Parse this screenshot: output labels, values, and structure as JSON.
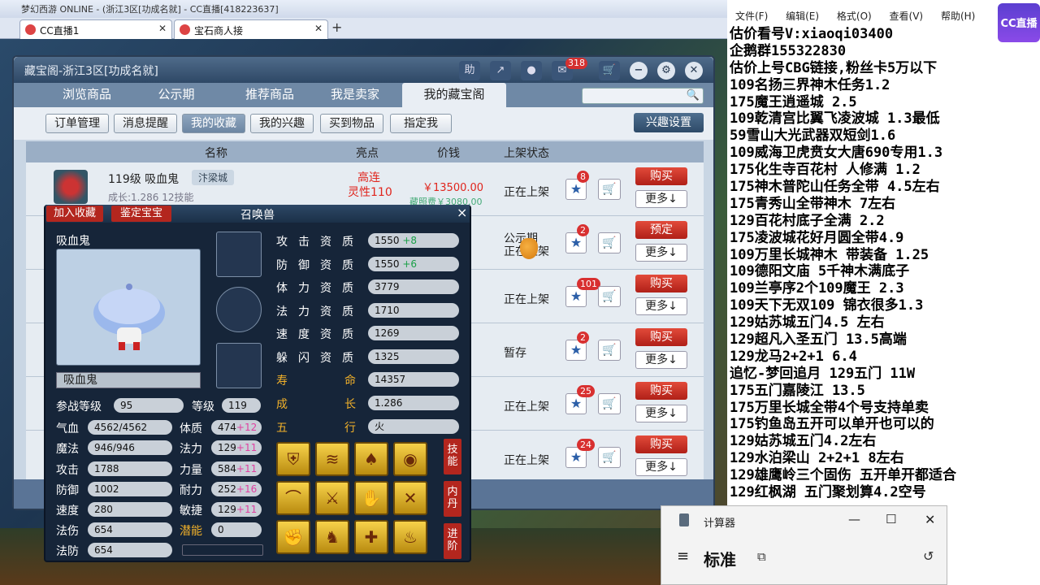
{
  "browser": {
    "window_title": "梦幻西游 ONLINE - (浙江3区[功成名就] - CC直播[418223637]",
    "tabs": [
      {
        "label": "CC直播1"
      },
      {
        "label": "宝石商人接"
      }
    ],
    "new_tab": "+"
  },
  "cbg": {
    "title": "藏宝阁-浙江3区[功成名就]",
    "help": "助",
    "msg_count": "318",
    "nav_tabs": [
      "浏览商品",
      "公示期",
      "推荐商品",
      "我是卖家",
      "我的藏宝阁"
    ],
    "sub_buttons": [
      "订单管理",
      "消息提醒",
      "我的收藏",
      "我的兴趣",
      "买到物品",
      "指定我"
    ],
    "interest_settings": "兴趣设置",
    "columns": {
      "name": "名称",
      "highlight": "亮点",
      "price": "价钱",
      "status": "上架状态"
    },
    "rows": [
      {
        "status": "正在上架",
        "count": "8",
        "action": "购买",
        "more": "更多↓"
      },
      {
        "status": "公示期",
        "count": "2",
        "action": "预定",
        "more": "更多↓"
      },
      {
        "status": "正在上架",
        "count": "101",
        "action": "购买",
        "more": "更多↓"
      },
      {
        "status": "暂存",
        "count": "2",
        "action": "购买",
        "more": "更多↓"
      },
      {
        "status": "正在上架",
        "count": "25",
        "action": "购买",
        "more": "更多↓"
      },
      {
        "status": "正在上架",
        "count": "24",
        "action": "购买",
        "more": "更多↓"
      }
    ],
    "row0": {
      "name": "119级 吸血鬼",
      "server": "汴梁城",
      "growth": "成长:1.286 12技能",
      "highlight1": "高连",
      "highlight2": "灵性110",
      "price": "￥13500.00",
      "sub": "藏照费￥3080.00"
    },
    "row1_status2": "正在上架"
  },
  "pet": {
    "add_fav": "加入收藏",
    "appraise": "鉴定宝宝",
    "title": "召唤兽",
    "close": "×",
    "name": "吸血鬼",
    "name_field": "吸血鬼",
    "aptitudes": [
      {
        "label": "攻击资质",
        "value": "1550",
        "bonus": "+8"
      },
      {
        "label": "防御资质",
        "value": "1550",
        "bonus": "+6"
      },
      {
        "label": "体力资质",
        "value": "3779",
        "bonus": ""
      },
      {
        "label": "法力资质",
        "value": "1710",
        "bonus": ""
      },
      {
        "label": "速度资质",
        "value": "1269",
        "bonus": ""
      },
      {
        "label": "躲闪资质",
        "value": "1325",
        "bonus": ""
      }
    ],
    "life": {
      "label1": "寿",
      "label2": "命",
      "value": "14357"
    },
    "growth": {
      "label1": "成",
      "label2": "长",
      "value": "1.286"
    },
    "element": {
      "label1": "五",
      "label2": "行",
      "value": "火"
    },
    "battle_level_label": "参战等级",
    "battle_level": "95",
    "level_label": "等级",
    "level": "119",
    "stats_left": [
      {
        "label": "气血",
        "value": "4562/4562"
      },
      {
        "label": "魔法",
        "value": "946/946"
      },
      {
        "label": "攻击",
        "value": "1788"
      },
      {
        "label": "防御",
        "value": "1002"
      },
      {
        "label": "速度",
        "value": "280"
      },
      {
        "label": "法伤",
        "value": "654"
      },
      {
        "label": "法防",
        "value": "654"
      }
    ],
    "stats_right": [
      {
        "label": "体质",
        "value": "474",
        "bonus": "+12"
      },
      {
        "label": "法力",
        "value": "129",
        "bonus": "+11"
      },
      {
        "label": "力量",
        "value": "584",
        "bonus": "+11"
      },
      {
        "label": "耐力",
        "value": "252",
        "bonus": "+16"
      },
      {
        "label": "敏捷",
        "value": "129",
        "bonus": "+11"
      },
      {
        "label": "潜能",
        "value": "0",
        "bonus": ""
      }
    ],
    "side_tabs": [
      "技能",
      "内丹",
      "进阶"
    ]
  },
  "notepad": {
    "menu": [
      "文件(F)",
      "编辑(E)",
      "格式(O)",
      "查看(V)",
      "帮助(H)"
    ],
    "lines": [
      "估价看号V:xiaoqi03400",
      "企鹅群155322830",
      "估价上号CBG链接,粉丝卡5万以下",
      "109名扬三界神木任务1.2",
      "175魔王逍遥城 2.5",
      "109乾清宫比翼飞凌波城 1.3最低",
      "59雪山大光武器双短剑1.6",
      "109威海卫虎贲女大唐690专用1.3",
      "175化生寺百花村 人修满 1.2",
      "175神木普陀山任务全带 4.5左右",
      "175青秀山全带神木  7左右",
      "129百花村底子全满 2.2",
      "175凌波城花好月圆全带4.9",
      "109万里长城神木 带装备  1.25",
      "109德阳文庙 5千神木满底子",
      "109兰亭序2个109魔王 2.3",
      "109天下无双109  锦衣很多1.3",
      "129姑苏城五门4.5 左右",
      "129超凡入圣五门  13.5高端",
      "129龙马2+2+1  6.4",
      "追忆-梦回追月 129五门 11W",
      "175五门嘉陵江 13.5",
      "175万里长城全带4个号支持单卖",
      "175钓鱼岛五开可以单开也可以的",
      "129姑苏城五门4.2左右",
      "129水泊梁山 2+2+1 8左右",
      "129雄鹰岭三个固伤 五开单开都适合",
      "129红枫湖 五门聚划算4.2空号"
    ]
  },
  "cc_logo": "CC直播",
  "calculator": {
    "title": "计算器",
    "mode": "标准",
    "menu_icon": "≡",
    "minimize": "—",
    "maximize": "☐",
    "close": "✕"
  }
}
